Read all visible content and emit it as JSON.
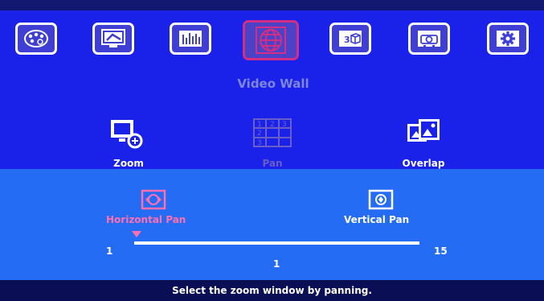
{
  "tabs": [
    {
      "name": "picture",
      "icon": "palette-icon",
      "active": false
    },
    {
      "name": "display",
      "icon": "monitor-edit-icon",
      "active": false
    },
    {
      "name": "audio",
      "icon": "equalizer-icon",
      "active": false
    },
    {
      "name": "video-wall",
      "icon": "globe-grid-icon",
      "active": true
    },
    {
      "name": "3d",
      "icon": "cube-icon",
      "active": false
    },
    {
      "name": "projector",
      "icon": "projector-icon",
      "active": false
    },
    {
      "name": "settings",
      "icon": "gear-icon",
      "active": false
    }
  ],
  "active_tab_title": "Video Wall",
  "submenu": {
    "zoom_label": "Zoom",
    "pan_label": "Pan",
    "overlap_label": "Overlap"
  },
  "pan_options": {
    "horizontal_label": "Horizontal Pan",
    "vertical_label": "Vertical Pan"
  },
  "slider": {
    "min": "1",
    "max": "15",
    "value": "1",
    "value_fraction": 0
  },
  "status_text": "Select the zoom window by panning.",
  "colors": {
    "background": "#1a22ea",
    "panel": "#246cf3",
    "highlight": "#ff6fb0",
    "active_border": "#d22e86",
    "dim_text": "#7f86d8"
  }
}
